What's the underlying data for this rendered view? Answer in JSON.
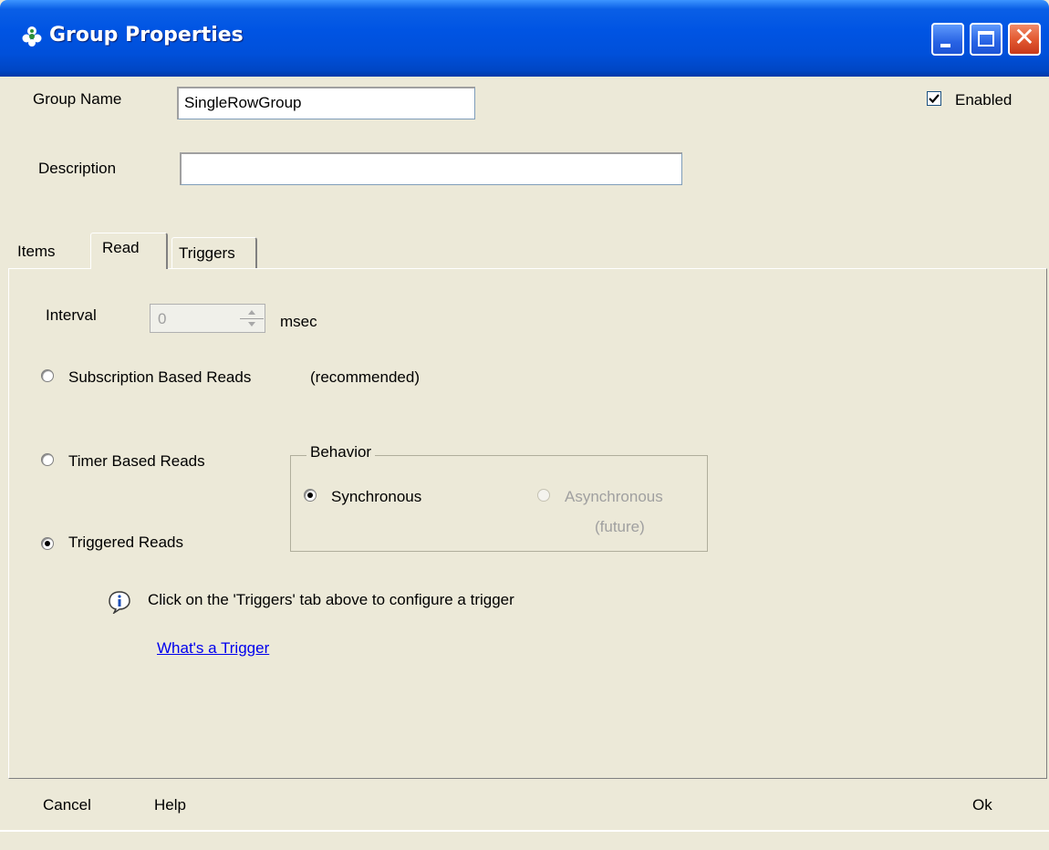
{
  "window": {
    "title": "Group Properties",
    "controls": {
      "minimize": "minimize-icon",
      "maximize": "maximize-icon",
      "close": "close-icon"
    }
  },
  "form": {
    "group_name_label": "Group Name",
    "group_name_value": "SingleRowGroup",
    "description_label": "Description",
    "description_value": "",
    "enabled_label": "Enabled",
    "enabled_checked": true
  },
  "tabs": [
    {
      "label": "Items",
      "active": false
    },
    {
      "label": "Read",
      "active": true
    },
    {
      "label": "Triggers",
      "active": false
    }
  ],
  "read": {
    "interval_label": "Interval",
    "interval_value": "0",
    "interval_unit": "msec",
    "options": [
      {
        "label": "Subscription Based Reads",
        "note": "(recommended)",
        "selected": false
      },
      {
        "label": "Timer Based Reads",
        "selected": false
      },
      {
        "label": "Triggered Reads",
        "selected": true
      }
    ],
    "behavior": {
      "legend": "Behavior",
      "synchronous_label": "Synchronous",
      "synchronous_selected": true,
      "asynchronous_label": "Asynchronous",
      "asynchronous_note": "(future)",
      "asynchronous_enabled": false
    },
    "info_text": "Click on the 'Triggers' tab above to configure a trigger",
    "info_icon": "info-icon",
    "link_text": "What's a Trigger"
  },
  "footer": {
    "cancel_label": "Cancel",
    "help_label": "Help",
    "ok_label": "Ok"
  },
  "colors": {
    "titlebar": "#0054e3",
    "face": "#ece9d8",
    "link": "#0000ee",
    "disabled_text": "#a0a0a0"
  }
}
